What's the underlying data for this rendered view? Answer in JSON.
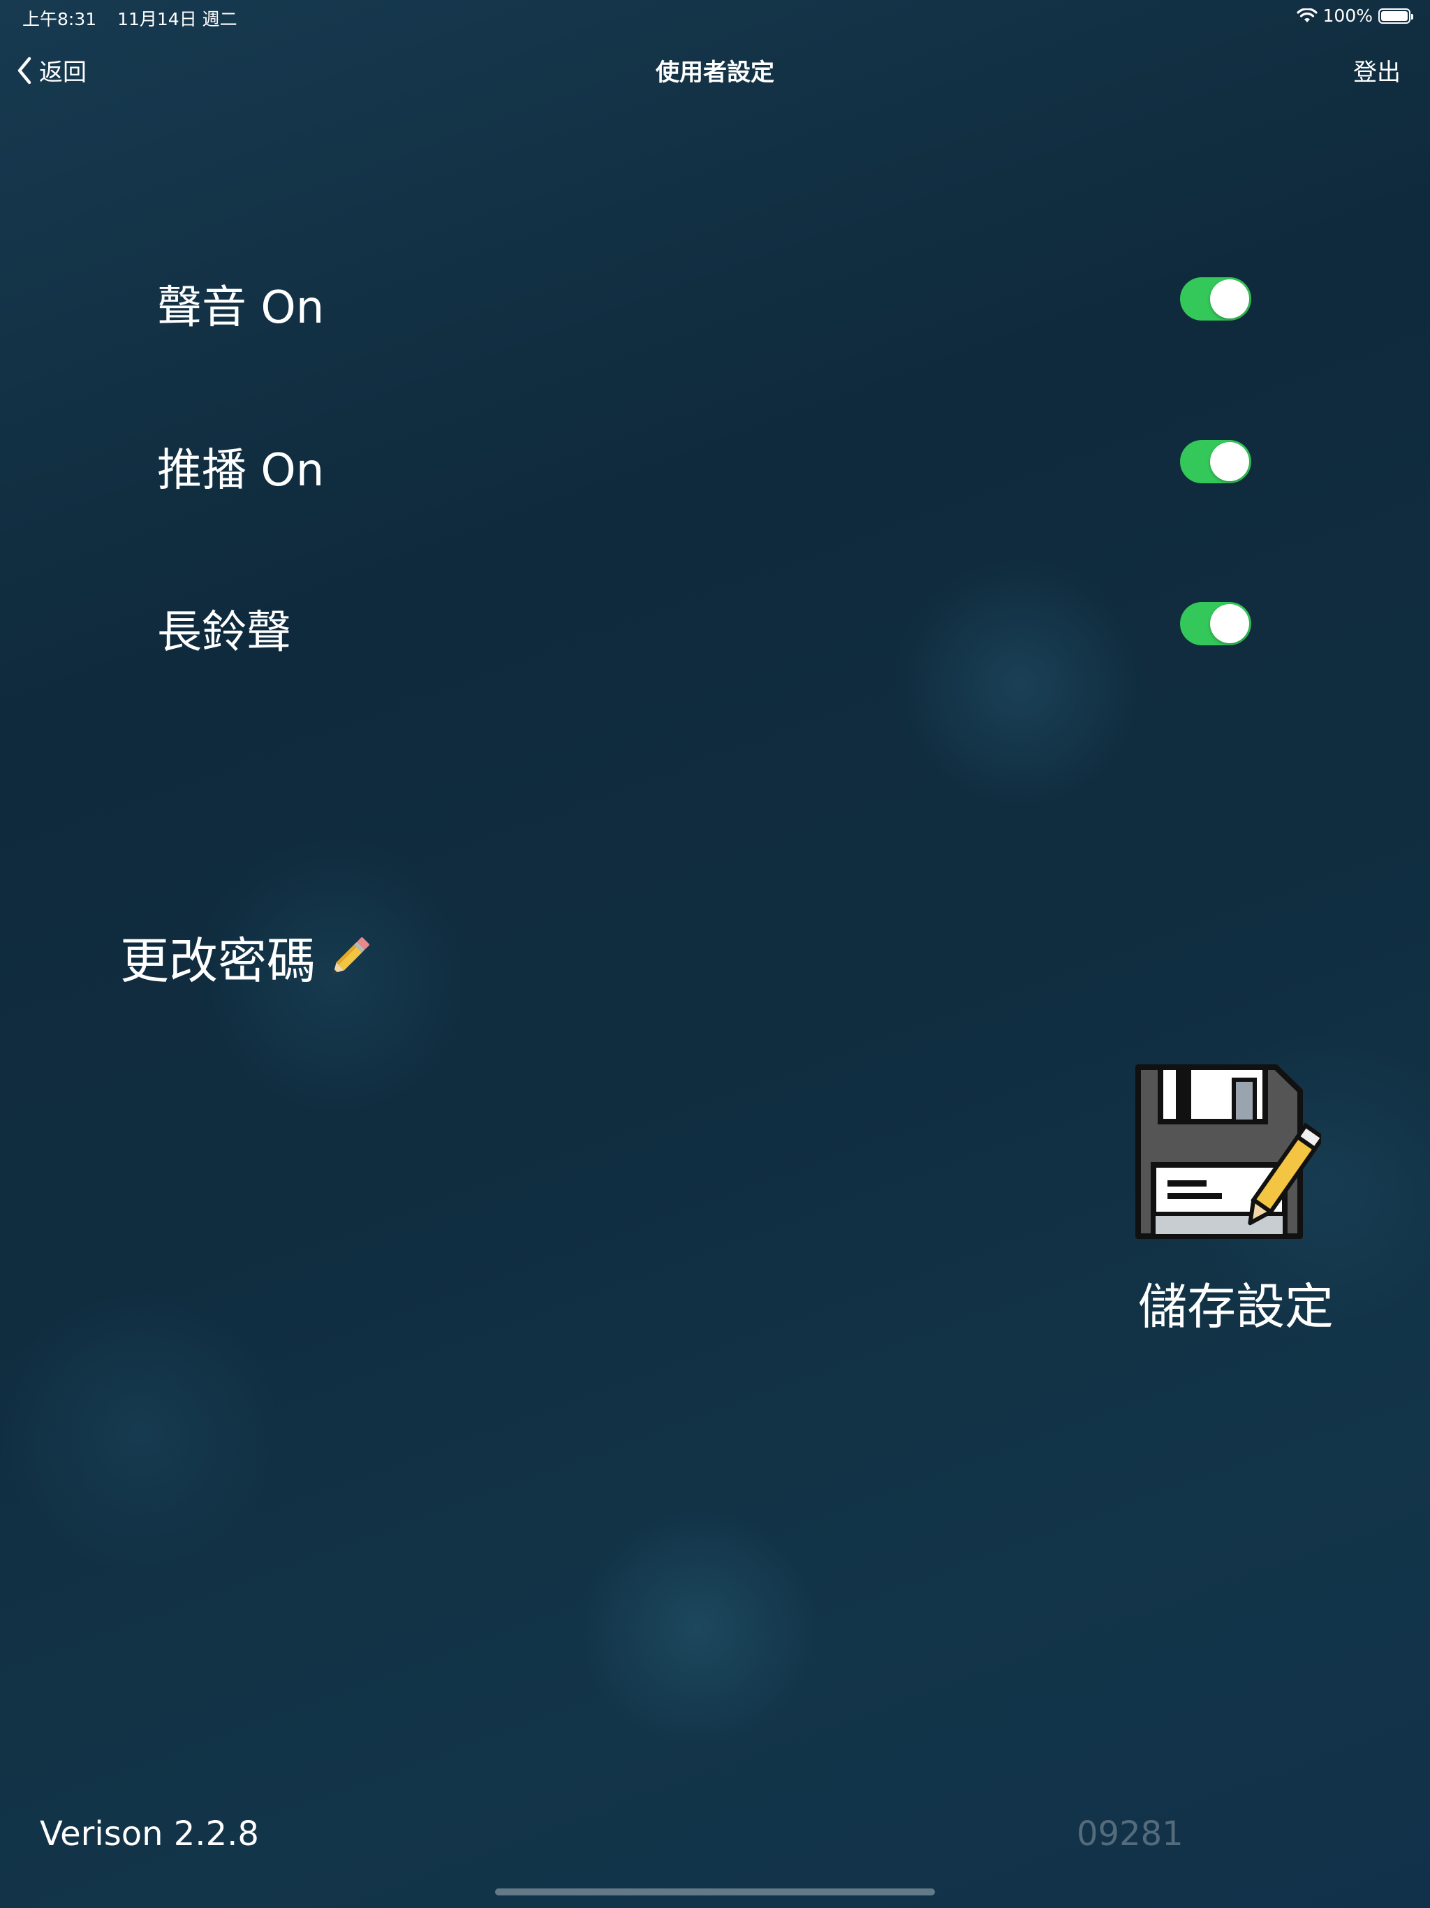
{
  "status_bar": {
    "time": "上午8:31",
    "date": "11月14日 週二",
    "battery": "100%",
    "battery_level": 1.0
  },
  "nav": {
    "back_label": "返回",
    "title": "使用者設定",
    "logout_label": "登出"
  },
  "settings": [
    {
      "label": "聲音 On",
      "enabled": true
    },
    {
      "label": "推播 On",
      "enabled": true
    },
    {
      "label": "長鈴聲",
      "enabled": true
    }
  ],
  "change_password": {
    "label": "更改密碼"
  },
  "save": {
    "label": "儲存設定"
  },
  "footer": {
    "version": "Verison 2.2.8",
    "phone": "09281"
  },
  "icons": {
    "back": "chevron-left-icon",
    "wifi": "wifi-icon",
    "battery": "battery-icon",
    "pencil": "pencil-icon",
    "save": "floppy-disk-pencil-icon"
  },
  "colors": {
    "toggle_on": "#34c759"
  }
}
